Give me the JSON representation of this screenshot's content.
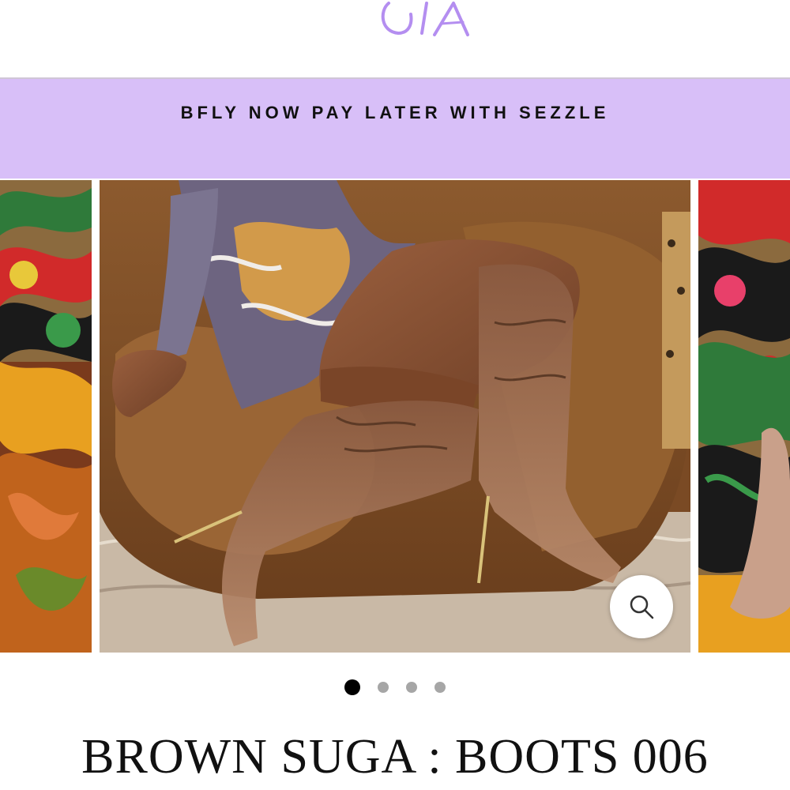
{
  "header": {
    "logo_icon": "script-monogram-logo",
    "logo_color": "#b48ef0"
  },
  "promo": {
    "text": "BFLY NOW PAY LATER WITH SEZZLE",
    "background": "#d8bff8"
  },
  "carousel": {
    "slides": [
      {
        "role": "previous",
        "icon": "product-photo"
      },
      {
        "role": "current",
        "icon": "product-photo"
      },
      {
        "role": "next",
        "icon": "product-photo"
      }
    ],
    "zoom_icon": "magnifier-icon",
    "dots": [
      {
        "active": true
      },
      {
        "active": false
      },
      {
        "active": false
      },
      {
        "active": false
      }
    ]
  },
  "product": {
    "title": "BROWN SUGA : BOOTS 006"
  }
}
